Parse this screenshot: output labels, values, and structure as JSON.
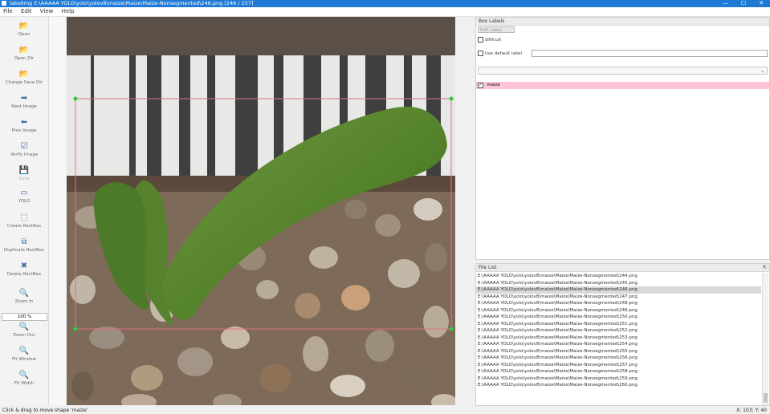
{
  "window": {
    "title": "labelImg E:\\AAAAA YOLO\\yolo\\yolov8\\maize\\Maize\\Maize-Nonsegmented\\246.png [246 / 257]",
    "minimize": "—",
    "maximize": "☐",
    "close": "✕"
  },
  "menu": [
    "File",
    "Edit",
    "View",
    "Help"
  ],
  "toolbar": {
    "items": [
      {
        "label": "Open",
        "icon": "open-icon",
        "glyph": "📂",
        "enabled": true
      },
      {
        "label": "Open Dir",
        "icon": "open-dir-icon",
        "glyph": "📂",
        "enabled": true
      },
      {
        "label": "Change Save Dir",
        "icon": "change-save-dir-icon",
        "glyph": "📂",
        "enabled": true
      },
      {
        "label": "Next Image",
        "icon": "next-image-icon",
        "glyph": "➡",
        "enabled": true
      },
      {
        "label": "Prev Image",
        "icon": "prev-image-icon",
        "glyph": "⬅",
        "enabled": true
      },
      {
        "label": "Verify Image",
        "icon": "verify-icon",
        "glyph": "☑",
        "enabled": true
      },
      {
        "label": "Save",
        "icon": "save-icon",
        "glyph": "💾",
        "enabled": false
      },
      {
        "label": "YOLO",
        "icon": "format-icon",
        "glyph": "▭",
        "enabled": true
      },
      {
        "label": "Create RectBox",
        "icon": "create-rectbox-icon",
        "glyph": "⬚",
        "enabled": true
      },
      {
        "label": "Duplicate RectBox",
        "icon": "duplicate-rectbox-icon",
        "glyph": "⧉",
        "enabled": true
      },
      {
        "label": "Delete RectBox",
        "icon": "delete-rectbox-icon",
        "glyph": "✖",
        "enabled": true
      },
      {
        "label": "Zoom In",
        "icon": "zoom-in-icon",
        "glyph": "🔍",
        "enabled": true
      },
      {
        "label": "Zoom Out",
        "icon": "zoom-out-icon",
        "glyph": "🔍",
        "enabled": true
      },
      {
        "label": "Fit Window",
        "icon": "fit-window-icon",
        "glyph": "🔍",
        "enabled": true
      },
      {
        "label": "Fit Width",
        "icon": "fit-width-icon",
        "glyph": "🔍",
        "enabled": true
      }
    ],
    "zoom_value": "100 %"
  },
  "box_labels": {
    "header": "Box Labels",
    "edit_label_button": "Edit Label",
    "difficult_label": "difficult",
    "use_default_label": "Use default label",
    "default_label_value": "",
    "labels": [
      {
        "name": "maize",
        "checked": true,
        "color": "#ffc4d8"
      }
    ]
  },
  "file_list": {
    "header": "File List",
    "base": "E:\\AAAAA YOLO\\yolo\\yolov8\\maize\\Maize\\Maize-Nonsegmented\\",
    "files": [
      "244.png",
      "245.png",
      "246.png",
      "247.png",
      "248.png",
      "249.png",
      "250.png",
      "251.png",
      "252.png",
      "253.png",
      "254.png",
      "255.png",
      "256.png",
      "257.png",
      "258.png",
      "259.png",
      "260.png"
    ],
    "selected": "246.png"
  },
  "status": {
    "message": "Click & drag to move shape 'maize'",
    "coords": "X: 103; Y: 40"
  }
}
